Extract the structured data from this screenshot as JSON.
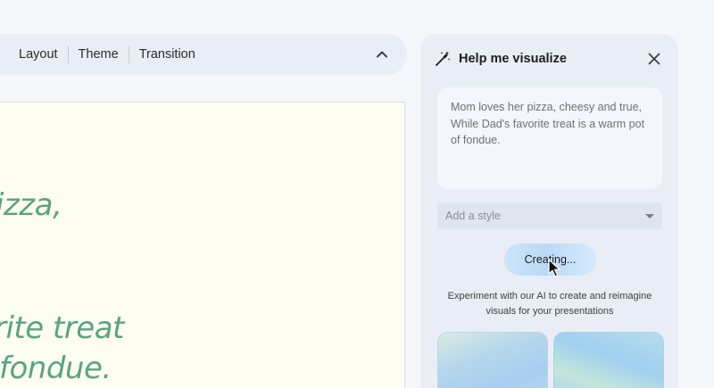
{
  "toolbar": {
    "items": [
      "Layout",
      "Theme",
      "Transition"
    ]
  },
  "slide": {
    "lines": [
      "izza,",
      "rite treat",
      "fondue."
    ]
  },
  "panel": {
    "title": "Help me visualize",
    "prompt_text": "Mom loves her pizza, cheesy and true, While Dad's favorite treat is a warm pot of fondue.",
    "style_placeholder": "Add a style",
    "create_label": "Creating...",
    "experiment_text": "Experiment with our AI to create and reimagine visuals for your presentations"
  },
  "icons": {
    "wand": "magic-wand-icon",
    "close": "close-icon",
    "collapse": "chevron-up-icon",
    "dropdown": "caret-down-icon"
  },
  "colors": {
    "accent_green": "#5aa383",
    "panel_bg": "#e9eef6",
    "slide_bg": "#fdfdf1"
  }
}
